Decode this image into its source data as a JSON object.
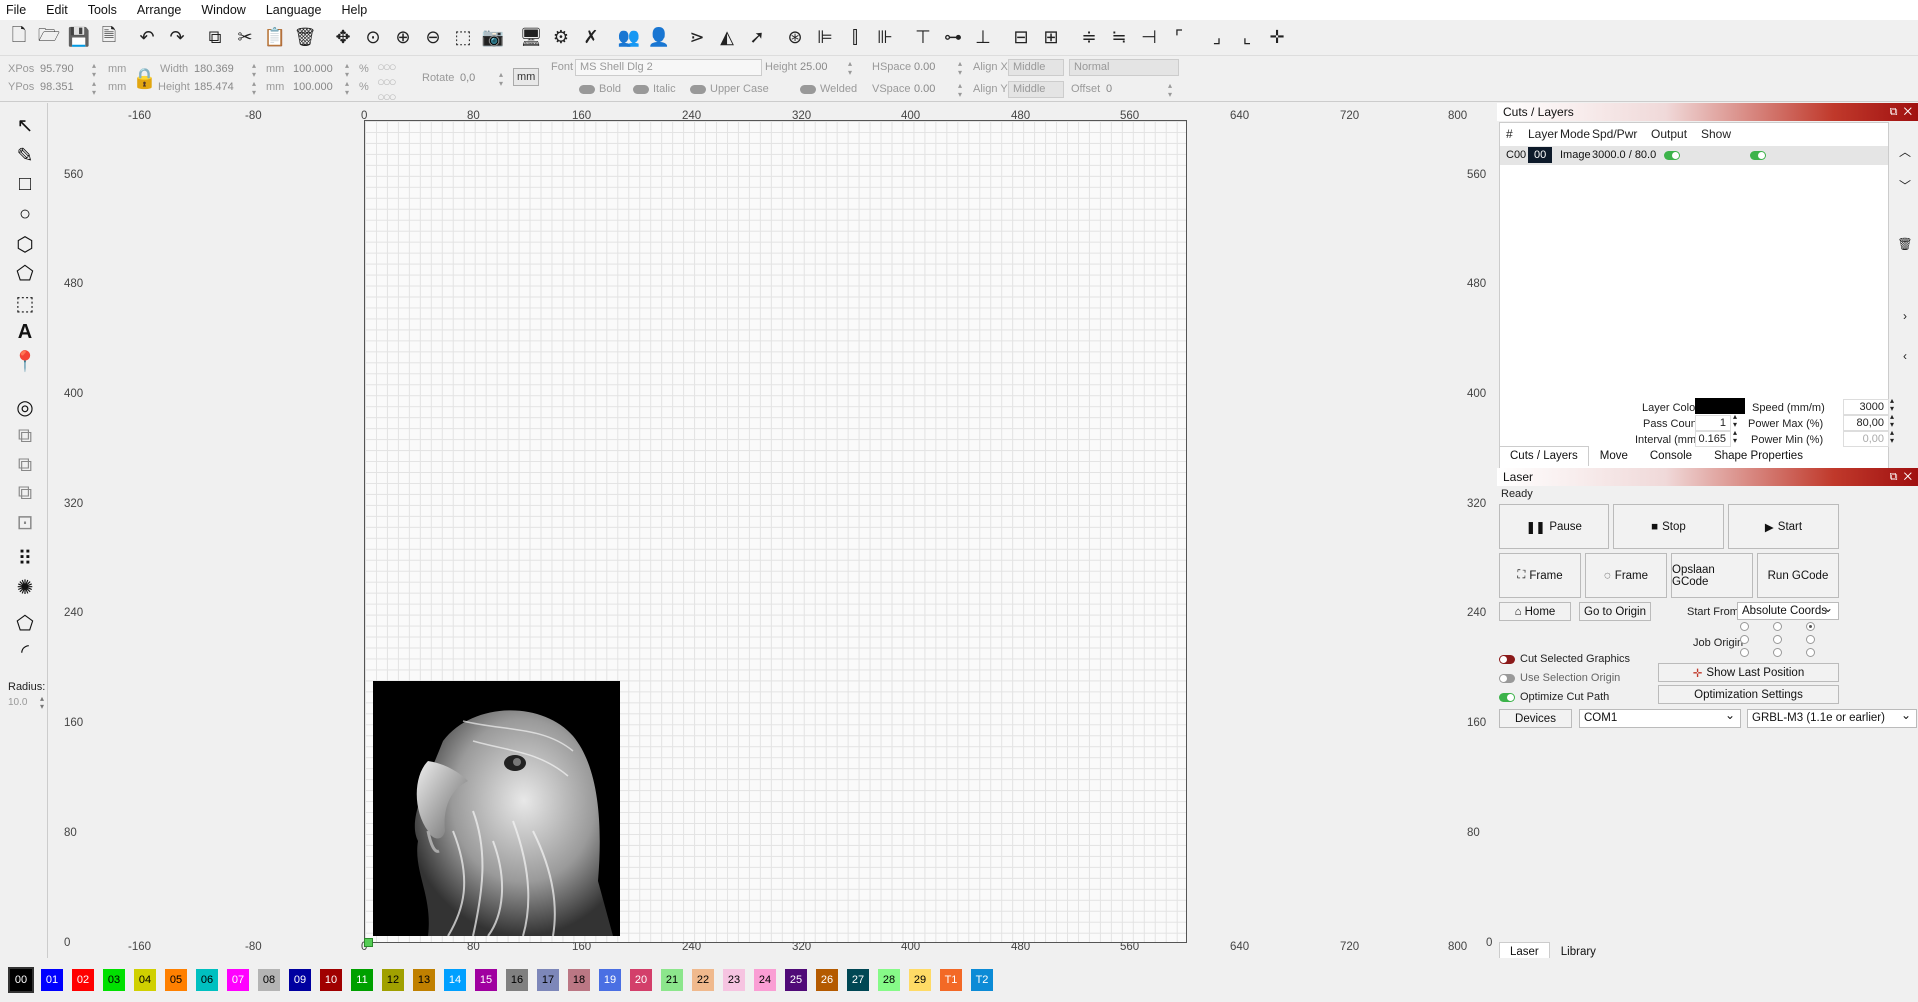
{
  "menu": [
    "File",
    "Edit",
    "Tools",
    "Arrange",
    "Window",
    "Language",
    "Help"
  ],
  "toolbar_icons": [
    "new-file-icon",
    "open-icon",
    "save-icon",
    "save-as-icon",
    "undo-icon",
    "redo-icon",
    "copy-icon",
    "cut-icon",
    "paste-icon",
    "delete-icon",
    "move-icon",
    "zoom-fit-icon",
    "zoom-in-icon",
    "zoom-out-icon",
    "select-frame-icon",
    "camera-icon",
    "monitor-icon",
    "settings-icon",
    "tools-icon",
    "group-icon",
    "ungroup-icon",
    "flip-h-icon",
    "mirror-icon",
    "send-icon",
    "target-icon",
    "align-left-icon",
    "align-center-icon",
    "align-right-icon",
    "align-top-icon",
    "align-middle-icon",
    "align-bottom-icon",
    "distribute-h-icon",
    "distribute-v-icon",
    "space-h-icon",
    "space-v-icon",
    "center-icon",
    "corner-tl-icon",
    "corner-tr-icon",
    "corner-br-icon",
    "crosshair-icon"
  ],
  "props": {
    "xpos_label": "XPos",
    "xpos": "95.790",
    "ypos_label": "YPos",
    "ypos": "98.351",
    "unit": "mm",
    "width_label": "Width",
    "width": "180.369",
    "height_label": "Height",
    "height": "185.474",
    "w_pct": "100.000",
    "h_pct": "100.000",
    "pct": "%",
    "rotate_label": "Rotate",
    "rotate": "0,0",
    "mm_btn": "mm",
    "font_label": "Font",
    "font_value": "MS Shell Dlg 2",
    "fheight_label": "Height",
    "fheight": "25.00",
    "hspace_label": "HSpace",
    "hspace": "0.00",
    "vspace_label": "VSpace",
    "vspace": "0.00",
    "alignx_label": "Align X",
    "alignx": "Middle",
    "aligny_label": "Align Y",
    "aligny": "Middle",
    "style": "Normal",
    "offset_label": "Offset",
    "offset": "0",
    "bold": "Bold",
    "italic": "Italic",
    "upper": "Upper Case",
    "welded": "Welded"
  },
  "left_tools": [
    "select-arrow-icon",
    "pencil-icon",
    "rectangle-icon",
    "ellipse-icon",
    "polygon-icon",
    "pentagon-icon",
    "bounding-box-icon",
    "text-icon",
    "position-marker-icon",
    "offset-icon",
    "weld-icon",
    "boolean-union-icon",
    "boolean-subtract-icon",
    "boolean-intersect-icon",
    "grid-array-icon",
    "circular-array-icon",
    "node-edit-icon",
    "corner-round-icon"
  ],
  "radius_label": "Radius:",
  "radius_value": "10.0",
  "rulers": {
    "top": [
      "-160",
      "-80",
      "0",
      "80",
      "160",
      "240",
      "320",
      "400",
      "480",
      "560",
      "640",
      "720",
      "800"
    ],
    "bottom": [
      "-160",
      "-80",
      "0",
      "80",
      "160",
      "240",
      "320",
      "400",
      "480",
      "560",
      "640",
      "720",
      "800"
    ],
    "left": [
      "560",
      "480",
      "400",
      "320",
      "240",
      "160",
      "80",
      "0"
    ],
    "right": [
      "560",
      "480",
      "400",
      "320",
      "240",
      "160",
      "80",
      "0"
    ]
  },
  "cuts_panel": {
    "title": "Cuts / Layers",
    "headers": [
      "#",
      "Layer",
      "Mode",
      "Spd/Pwr",
      "Output",
      "Show"
    ],
    "row": {
      "id": "C00",
      "layer": "00",
      "mode": "Image",
      "spdpwr": "3000.0 / 80.0"
    },
    "layer_color_label": "Layer Color",
    "speed_label": "Speed (mm/m)",
    "speed": "3000",
    "pass_label": "Pass Count",
    "pass": "1",
    "pmax_label": "Power Max (%)",
    "pmax": "80,00",
    "interval_label": "Interval (mm)",
    "interval": "0.165",
    "pmin_label": "Power Min (%)",
    "pmin": "0,00",
    "tabs": [
      "Cuts / Layers",
      "Move",
      "Console",
      "Shape Properties"
    ]
  },
  "laser_panel": {
    "title": "Laser",
    "status": "Ready",
    "pause": "Pause",
    "stop": "Stop",
    "start": "Start",
    "frame1": "Frame",
    "frame2": "Frame",
    "save_gcode": "Opslaan GCode",
    "run_gcode": "Run GCode",
    "home": "Home",
    "go_origin": "Go to Origin",
    "start_from_label": "Start From:",
    "start_from": "Absolute Coords",
    "job_origin_label": "Job Origin",
    "cut_selected": "Cut Selected Graphics",
    "use_selection": "Use Selection Origin",
    "optimize": "Optimize Cut Path",
    "show_last": "Show Last Position",
    "opt_settings": "Optimization Settings",
    "devices": "Devices",
    "port": "COM1",
    "device": "GRBL-M3 (1.1e or earlier)",
    "tabs": [
      "Laser",
      "Library"
    ]
  },
  "palette": [
    {
      "label": "00",
      "bg": "#000000",
      "fg": "#ffffff"
    },
    {
      "label": "01",
      "bg": "#0000ff",
      "fg": "#ffffff"
    },
    {
      "label": "02",
      "bg": "#ff0000",
      "fg": "#ffffff"
    },
    {
      "label": "03",
      "bg": "#00e000",
      "fg": "#000000"
    },
    {
      "label": "04",
      "bg": "#d0d000",
      "fg": "#000000"
    },
    {
      "label": "05",
      "bg": "#ff8000",
      "fg": "#000000"
    },
    {
      "label": "06",
      "bg": "#00c0c0",
      "fg": "#000000"
    },
    {
      "label": "07",
      "bg": "#ff00ff",
      "fg": "#ffffff"
    },
    {
      "label": "08",
      "bg": "#b4b4b4",
      "fg": "#000000"
    },
    {
      "label": "09",
      "bg": "#0000a0",
      "fg": "#ffffff"
    },
    {
      "label": "10",
      "bg": "#a00000",
      "fg": "#ffffff"
    },
    {
      "label": "11",
      "bg": "#00a000",
      "fg": "#ffffff"
    },
    {
      "label": "12",
      "bg": "#a0a000",
      "fg": "#000000"
    },
    {
      "label": "13",
      "bg": "#c08000",
      "fg": "#000000"
    },
    {
      "label": "14",
      "bg": "#00a0ff",
      "fg": "#ffffff"
    },
    {
      "label": "15",
      "bg": "#a000a0",
      "fg": "#ffffff"
    },
    {
      "label": "16",
      "bg": "#808080",
      "fg": "#000000"
    },
    {
      "label": "17",
      "bg": "#7d87b9",
      "fg": "#000000"
    },
    {
      "label": "18",
      "bg": "#bb7784",
      "fg": "#000000"
    },
    {
      "label": "19",
      "bg": "#4a6fe3",
      "fg": "#ffffff"
    },
    {
      "label": "20",
      "bg": "#d33f6a",
      "fg": "#ffffff"
    },
    {
      "label": "21",
      "bg": "#8ce68c",
      "fg": "#000000"
    },
    {
      "label": "22",
      "bg": "#f0b98d",
      "fg": "#000000"
    },
    {
      "label": "23",
      "bg": "#f6c4e1",
      "fg": "#000000"
    },
    {
      "label": "24",
      "bg": "#fa9ed4",
      "fg": "#000000"
    },
    {
      "label": "25",
      "bg": "#500a78",
      "fg": "#ffffff"
    },
    {
      "label": "26",
      "bg": "#b45a00",
      "fg": "#ffffff"
    },
    {
      "label": "27",
      "bg": "#004754",
      "fg": "#ffffff"
    },
    {
      "label": "28",
      "bg": "#86fa88",
      "fg": "#000000"
    },
    {
      "label": "29",
      "bg": "#ffdb66",
      "fg": "#000000"
    },
    {
      "label": "T1",
      "bg": "#f36926",
      "fg": "#ffffff"
    },
    {
      "label": "T2",
      "bg": "#0c8bd6",
      "fg": "#ffffff"
    }
  ]
}
